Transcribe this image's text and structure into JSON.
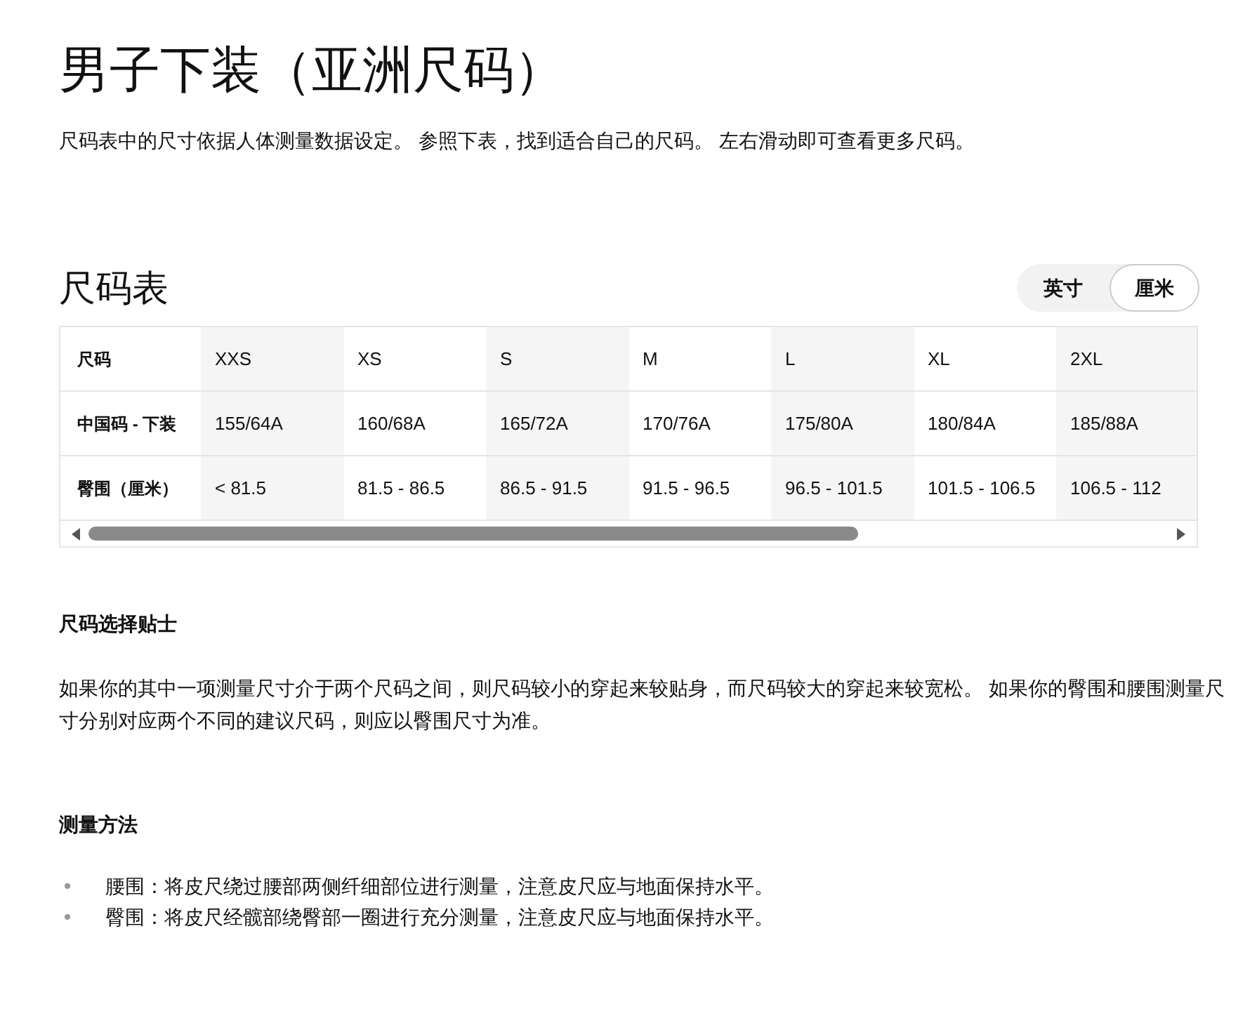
{
  "title": "男子下装（亚洲尺码）",
  "intro": "尺码表中的尺寸依据人体测量数据设定。 参照下表，找到适合自己的尺码。 左右滑动即可查看更多尺码。",
  "size_chart": {
    "heading": "尺码表",
    "units": [
      {
        "label": "英寸",
        "selected": false
      },
      {
        "label": "厘米",
        "selected": true
      }
    ],
    "rows": [
      {
        "label": "尺码",
        "cells": [
          "XXS",
          "XS",
          "S",
          "M",
          "L",
          "XL",
          "2XL"
        ]
      },
      {
        "label": "中国码 - 下装",
        "cells": [
          "155/64A",
          "160/68A",
          "165/72A",
          "170/76A",
          "175/80A",
          "180/84A",
          "185/88A"
        ]
      },
      {
        "label": "臀围（厘米）",
        "cells": [
          "< 81.5",
          "81.5 - 86.5",
          "86.5 - 91.5",
          "91.5 - 96.5",
          "96.5 - 101.5",
          "101.5 - 106.5",
          "106.5 - 112"
        ]
      }
    ]
  },
  "tips": {
    "heading": "尺码选择贴士",
    "text": "如果你的其中一项测量尺寸介于两个尺码之间，则尺码较小的穿起来较贴身，而尺码较大的穿起来较宽松。 如果你的臀围和腰围测量尺寸分别对应两个不同的建议尺码，则应以臀围尺寸为准。"
  },
  "measure": {
    "heading": "测量方法",
    "items": [
      "腰围：将皮尺绕过腰部两侧纤细部位进行测量，注意皮尺应与地面保持水平。",
      "臀围：将皮尺经髋部绕臀部一圈进行充分测量，注意皮尺应与地面保持水平。"
    ]
  }
}
